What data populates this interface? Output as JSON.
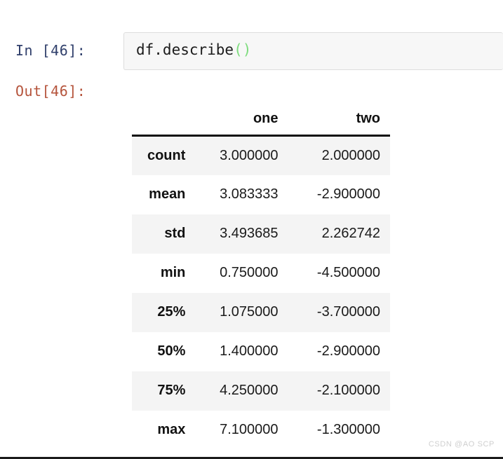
{
  "cell": {
    "in_prompt": "In [46]:",
    "out_prompt": "Out[46]:",
    "code_main": "df.describe",
    "code_parens": "()",
    "prompt_in_color": "#303f6b",
    "prompt_out_color": "#b5543c",
    "paren_color": "#7ddc7d"
  },
  "watermark": {
    "text": "CSDN @AO SCP"
  },
  "chart_data": {
    "type": "table",
    "title": "df.describe()",
    "index_header": "",
    "categories": [
      "one",
      "two"
    ],
    "index": [
      "count",
      "mean",
      "std",
      "min",
      "25%",
      "50%",
      "75%",
      "max"
    ],
    "rows": [
      {
        "label": "count",
        "one": "3.000000",
        "two": "2.000000"
      },
      {
        "label": "mean",
        "one": "3.083333",
        "two": "-2.900000"
      },
      {
        "label": "std",
        "one": "3.493685",
        "two": "2.262742"
      },
      {
        "label": "min",
        "one": "0.750000",
        "two": "-4.500000"
      },
      {
        "label": "25%",
        "one": "1.075000",
        "two": "-3.700000"
      },
      {
        "label": "50%",
        "one": "1.400000",
        "two": "-2.900000"
      },
      {
        "label": "75%",
        "one": "4.250000",
        "two": "-2.100000"
      },
      {
        "label": "max",
        "one": "7.100000",
        "two": "-1.300000"
      }
    ],
    "series": [
      {
        "name": "one",
        "values": [
          3.0,
          3.083333,
          3.493685,
          0.75,
          1.075,
          1.4,
          4.25,
          7.1
        ]
      },
      {
        "name": "two",
        "values": [
          2.0,
          -2.9,
          2.262742,
          -4.5,
          -3.7,
          -2.9,
          -2.1,
          -1.3
        ]
      }
    ],
    "xlabel": "",
    "ylabel": "",
    "grid": false,
    "legend": "none"
  }
}
